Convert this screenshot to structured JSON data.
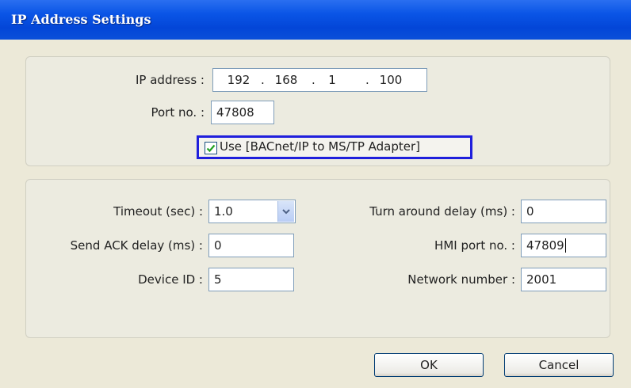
{
  "window": {
    "title": "IP Address Settings"
  },
  "network": {
    "ip_label": "IP address :",
    "ip_octets": [
      "192",
      "168",
      "1",
      "100"
    ],
    "ip_separator": ".",
    "port_label": "Port no. :",
    "port_value": "47808",
    "adapter_checkbox": {
      "label": "Use [BACnet/IP to MS/TP Adapter]",
      "checked": true
    }
  },
  "settings": {
    "timeout_label": "Timeout (sec) :",
    "timeout_value": "1.0",
    "send_ack_label": "Send ACK delay (ms) :",
    "send_ack_value": "0",
    "device_id_label": "Device ID :",
    "device_id_value": "5",
    "turnaround_label": "Turn around delay (ms) :",
    "turnaround_value": "0",
    "hmi_port_label": "HMI port no. :",
    "hmi_port_value": "47809",
    "network_number_label": "Network number :",
    "network_number_value": "2001"
  },
  "buttons": {
    "ok": "OK",
    "cancel": "Cancel"
  },
  "colors": {
    "titlebar": "#0a55e6",
    "highlight_border": "#1f1fdc",
    "dialog_bg": "#ece9d8"
  }
}
